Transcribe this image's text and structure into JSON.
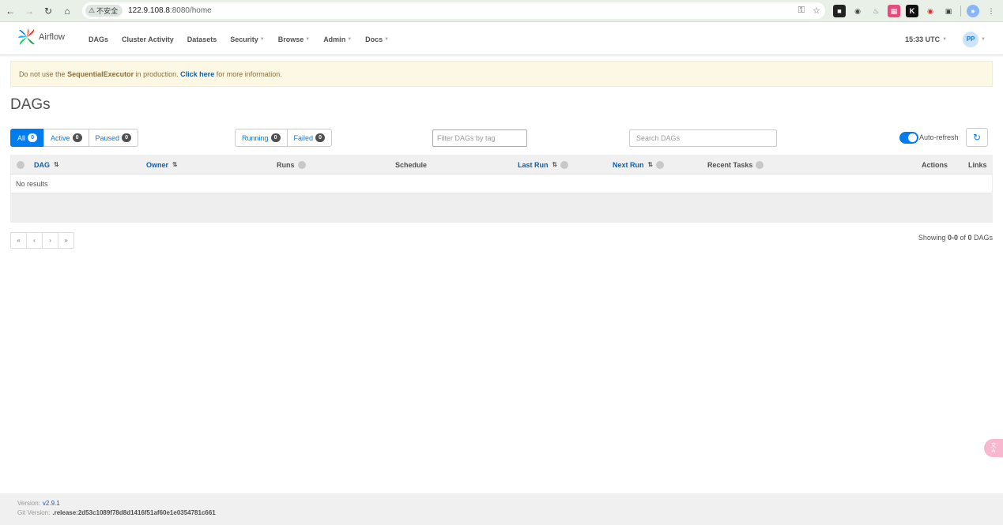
{
  "browser": {
    "security_label": "不安全",
    "url_host": "122.9.108.8",
    "url_rest": ":8080/home"
  },
  "nav": {
    "brand": "Airflow",
    "items": [
      {
        "label": "DAGs",
        "dropdown": false
      },
      {
        "label": "Cluster Activity",
        "dropdown": false
      },
      {
        "label": "Datasets",
        "dropdown": false
      },
      {
        "label": "Security",
        "dropdown": true
      },
      {
        "label": "Browse",
        "dropdown": true
      },
      {
        "label": "Admin",
        "dropdown": true
      },
      {
        "label": "Docs",
        "dropdown": true
      }
    ],
    "clock": "15:33 UTC",
    "avatar": "PP"
  },
  "alert": {
    "prefix": "Do not use the ",
    "executor": "SequentialExecutor",
    "middle": " in production. ",
    "link": "Click here",
    "suffix": " for more information."
  },
  "page_title": "DAGs",
  "status_filter": [
    {
      "label": "All",
      "count": "0",
      "active": true
    },
    {
      "label": "Active",
      "count": "0",
      "active": false
    },
    {
      "label": "Paused",
      "count": "0",
      "active": false
    }
  ],
  "run_filter": [
    {
      "label": "Running",
      "count": "0"
    },
    {
      "label": "Failed",
      "count": "0"
    }
  ],
  "tag_filter_placeholder": "Filter DAGs by tag",
  "search_placeholder": "Search DAGs",
  "auto_refresh_label": "Auto-refresh",
  "table": {
    "columns": {
      "dag": "DAG",
      "owner": "Owner",
      "runs": "Runs",
      "schedule": "Schedule",
      "last_run": "Last Run",
      "next_run": "Next Run",
      "recent_tasks": "Recent Tasks",
      "actions": "Actions",
      "links": "Links"
    },
    "empty_text": "No results"
  },
  "pagination": [
    "«",
    "‹",
    "›",
    "»"
  ],
  "showing": {
    "prefix": "Showing ",
    "range": "0-0",
    "of": " of ",
    "total": "0",
    "suffix": " DAGs"
  },
  "footer": {
    "version_label": "Version:",
    "version": "v2.9.1",
    "git_label": "Git Version:",
    "git": ".release:2d53c1089f78d8d1416f51af60e1e0354781c661"
  }
}
